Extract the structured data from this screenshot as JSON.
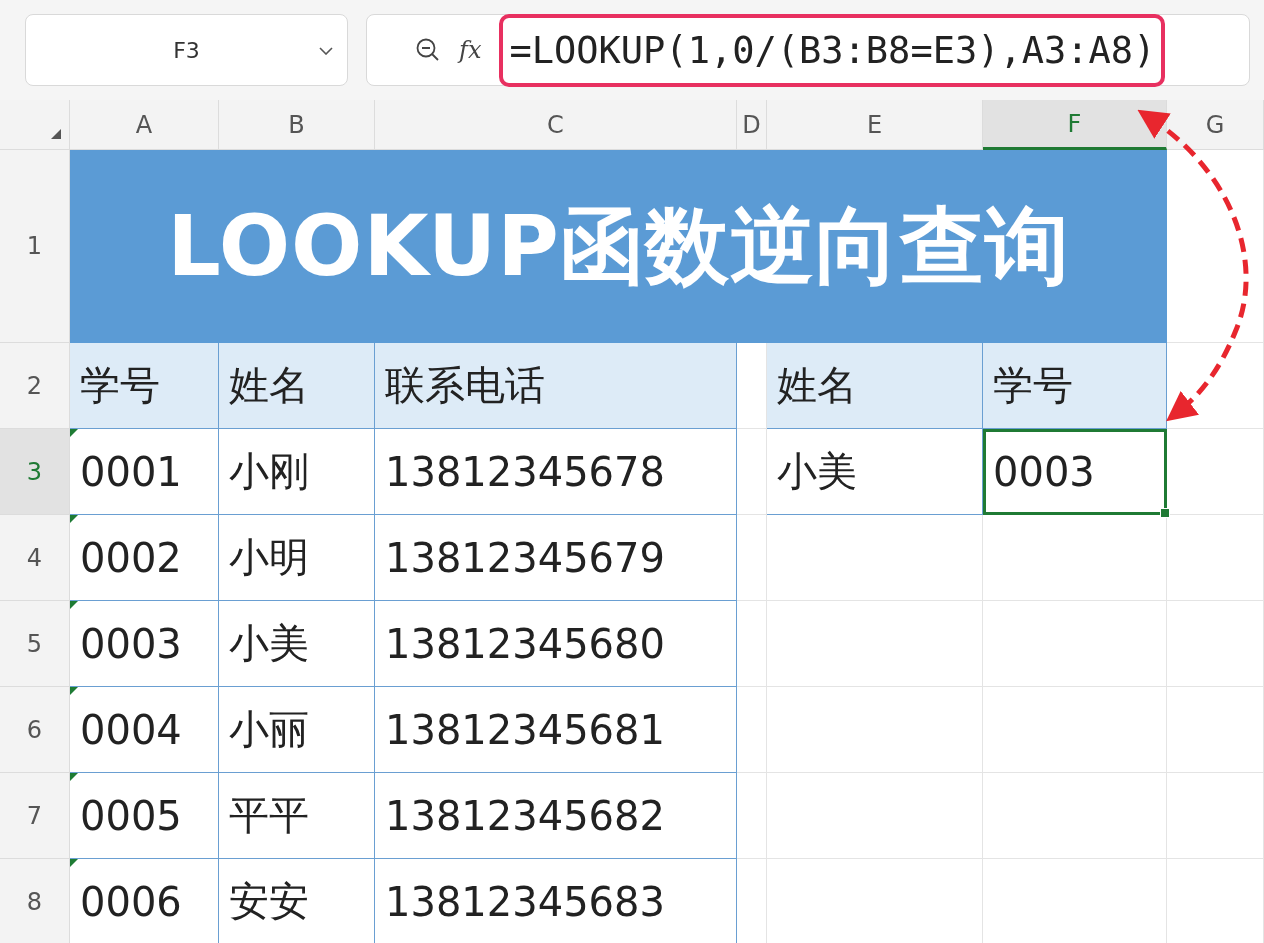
{
  "name_box": "F3",
  "fx_symbol": "fx",
  "formula": "=LOOKUP(1,0/(B3:B8=E3),A3:A8)",
  "columns": [
    {
      "label": "A",
      "selected": false
    },
    {
      "label": "B",
      "selected": false
    },
    {
      "label": "C",
      "selected": false
    },
    {
      "label": "D",
      "selected": false
    },
    {
      "label": "E",
      "selected": false
    },
    {
      "label": "F",
      "selected": true
    },
    {
      "label": "G",
      "selected": false
    }
  ],
  "row_headers": [
    {
      "label": "1",
      "selected": false
    },
    {
      "label": "2",
      "selected": false
    },
    {
      "label": "3",
      "selected": true
    },
    {
      "label": "4",
      "selected": false
    },
    {
      "label": "5",
      "selected": false
    },
    {
      "label": "6",
      "selected": false
    },
    {
      "label": "7",
      "selected": false
    },
    {
      "label": "8",
      "selected": false
    }
  ],
  "title": "LOOKUP函数逆向查询",
  "table": {
    "headers": [
      "学号",
      "姓名",
      "联系电话"
    ],
    "rows": [
      [
        "0001",
        "小刚",
        "13812345678"
      ],
      [
        "0002",
        "小明",
        "13812345679"
      ],
      [
        "0003",
        "小美",
        "13812345680"
      ],
      [
        "0004",
        "小丽",
        "13812345681"
      ],
      [
        "0005",
        "平平",
        "13812345682"
      ],
      [
        "0006",
        "安安",
        "13812345683"
      ]
    ]
  },
  "lookup": {
    "headers": [
      "姓名",
      "学号"
    ],
    "query": "小美",
    "result": "0003",
    "result_selected": true
  }
}
